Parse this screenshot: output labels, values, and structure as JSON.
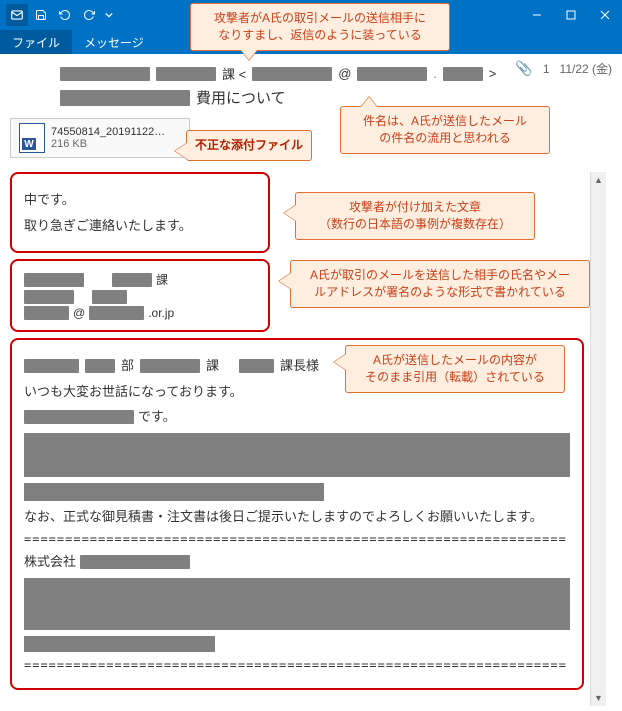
{
  "titlebar": {
    "attach_count": "1",
    "date": "11/22 (金)"
  },
  "tabs": {
    "file": "ファイル",
    "message": "メッセージ"
  },
  "header": {
    "from_suffix": "課 <",
    "from_at": "@",
    "from_close": ">",
    "subject_suffix": "費用について"
  },
  "attachment": {
    "filename": "74550814_20191122…",
    "size": "216 KB"
  },
  "callouts": {
    "spoof": "攻撃者がA氏の取引メールの送信相手に\nなりすまし、返信のように装っている",
    "subject": "件名は、A氏が送信したメール\nの件名の流用と思われる",
    "attach": "不正な添付ファイル",
    "added": "攻撃者が付け加えた文章\n（数行の日本語の事例が複数存在）",
    "sig": "A氏が取引のメールを送信した相手の氏名やメー\nルアドレスが署名のような形式で書かれている",
    "quoted": "A氏が送信したメールの内容が\nそのまま引用（転載）されている"
  },
  "body": {
    "added1": "中です。",
    "added2": "取り急ぎご連絡いたします。",
    "sig_suffix1": "課",
    "sig_domain": ".or.jp",
    "quoted_dept": "部",
    "quoted_sec": "課",
    "quoted_hon": "課長様",
    "quoted_greet": "いつも大変お世話になっております。",
    "quoted_cosuf": "です。",
    "quoted_note": "なお、正式な御見積書・注文書は後日ご提示いたしますのでよろしくお願いいたします。",
    "company_label": "株式会社"
  }
}
